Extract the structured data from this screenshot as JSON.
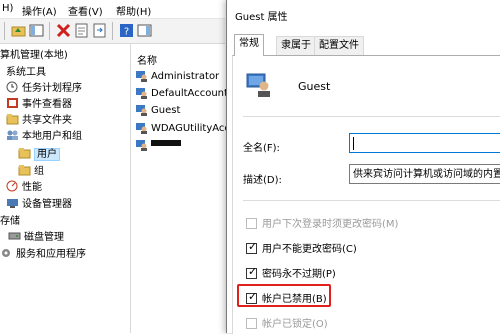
{
  "menu": {
    "items": [
      {
        "label": "H)"
      },
      {
        "label": "操作(A)"
      },
      {
        "label": "查看(V)"
      },
      {
        "label": "帮助(H)"
      }
    ]
  },
  "tree": {
    "items": [
      {
        "label": "算机管理(本地)"
      },
      {
        "label": "系统工具"
      },
      {
        "label": "任务计划程序"
      },
      {
        "label": "事件查看器"
      },
      {
        "label": "共享文件夹"
      },
      {
        "label": "本地用户和组"
      },
      {
        "label": "用户"
      },
      {
        "label": "组"
      },
      {
        "label": "性能"
      },
      {
        "label": "设备管理器"
      },
      {
        "label": "存储"
      },
      {
        "label": "磁盘管理"
      },
      {
        "label": "服务和应用程序"
      }
    ]
  },
  "list": {
    "header": "名称",
    "rows": [
      {
        "label": "Administrator"
      },
      {
        "label": "DefaultAccount"
      },
      {
        "label": "Guest"
      },
      {
        "label": "WDAGUtilityAcc"
      },
      {
        "label": ""
      }
    ]
  },
  "dialog": {
    "title": "Guest 属性",
    "tabs": [
      {
        "label": "常规"
      },
      {
        "label": "隶属于"
      },
      {
        "label": "配置文件"
      }
    ],
    "user_name": "Guest",
    "fullname_label": "全名(F):",
    "fullname_value": "",
    "description_label": "描述(D):",
    "description_value": "供来宾访问计算机或访问域的内置",
    "checkboxes": [
      {
        "label": "用户下次登录时须更改密码(M)",
        "checked": false,
        "enabled": false
      },
      {
        "label": "用户不能更改密码(C)",
        "checked": true,
        "enabled": true
      },
      {
        "label": "密码永不过期(P)",
        "checked": true,
        "enabled": true
      },
      {
        "label": "帐户已禁用(B)",
        "checked": true,
        "enabled": true,
        "highlighted": true
      },
      {
        "label": "帐户已锁定(O)",
        "checked": false,
        "enabled": false
      }
    ]
  },
  "colors": {
    "highlight_border": "#e0201b",
    "selection_bg": "#cce8ff"
  }
}
